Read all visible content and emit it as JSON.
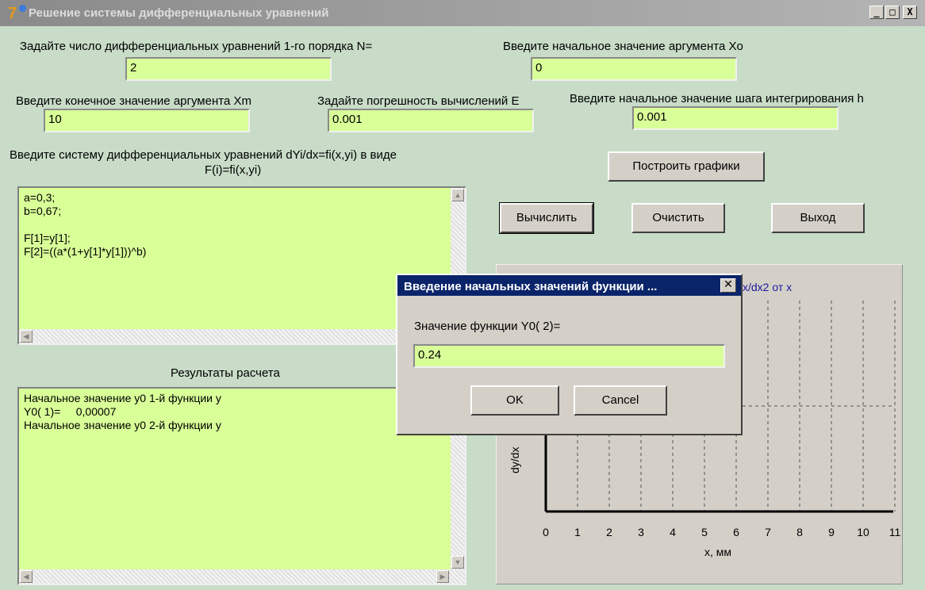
{
  "window": {
    "title": "Решение системы дифференциальных уравнений",
    "minimize": "_",
    "maximize": "□",
    "close": "X"
  },
  "form": {
    "n_label": "Задайте число дифференциальных уравнений 1-го порядка N=",
    "n_value": "2",
    "x0_label": "Введите начальное значение аргумента Xo",
    "x0_value": "0",
    "xm_label": "Введите конечное значение аргумента Xm",
    "xm_value": "10",
    "eps_label": "Задайте погрешность вычислений E",
    "eps_value": "0.001",
    "h_label": "Введите начальное значение шага интегрирования  h",
    "h_value": "0.001",
    "system_label_line1": "Введите систему дифференциальных уравнений dYi/dx=fi(x,yi) в виде",
    "system_label_line2": "F(i)=fi(x,yi)",
    "system_lines": [
      "a=0,3;",
      "b=0,67;",
      "",
      "F[1]=y[1];",
      "F[2]=((a*(1+y[1]*y[1]))^b)"
    ],
    "results_label": "Результаты расчета",
    "results_lines": [
      "Начальное значение y0 1-й функции y",
      "Y0( 1)=     0,00007",
      "Начальное значение y0 2-й функции y"
    ]
  },
  "buttons": {
    "plot": "Построить графики",
    "compute": "Вычислить",
    "clear": "Очистить",
    "exit": "Выход"
  },
  "plot": {
    "title_fragment": "x/dx2 от x",
    "ylabel": "dy/dx",
    "xlabel": "x, мм",
    "xticks": [
      "0",
      "1",
      "2",
      "3",
      "4",
      "5",
      "6",
      "7",
      "8",
      "9",
      "10",
      "11"
    ],
    "axis_color": "#000000",
    "title_color": "#1a1aa0"
  },
  "dialog": {
    "title": "Введение начальных значений функции ...",
    "close": "✕",
    "prompt": "Значение функции Y0( 2)=",
    "value": "0.24",
    "ok": "OK",
    "cancel": "Cancel"
  },
  "icons": {
    "scroll_up": "▲",
    "scroll_down": "▼",
    "scroll_left": "◀",
    "scroll_right": "▶"
  }
}
